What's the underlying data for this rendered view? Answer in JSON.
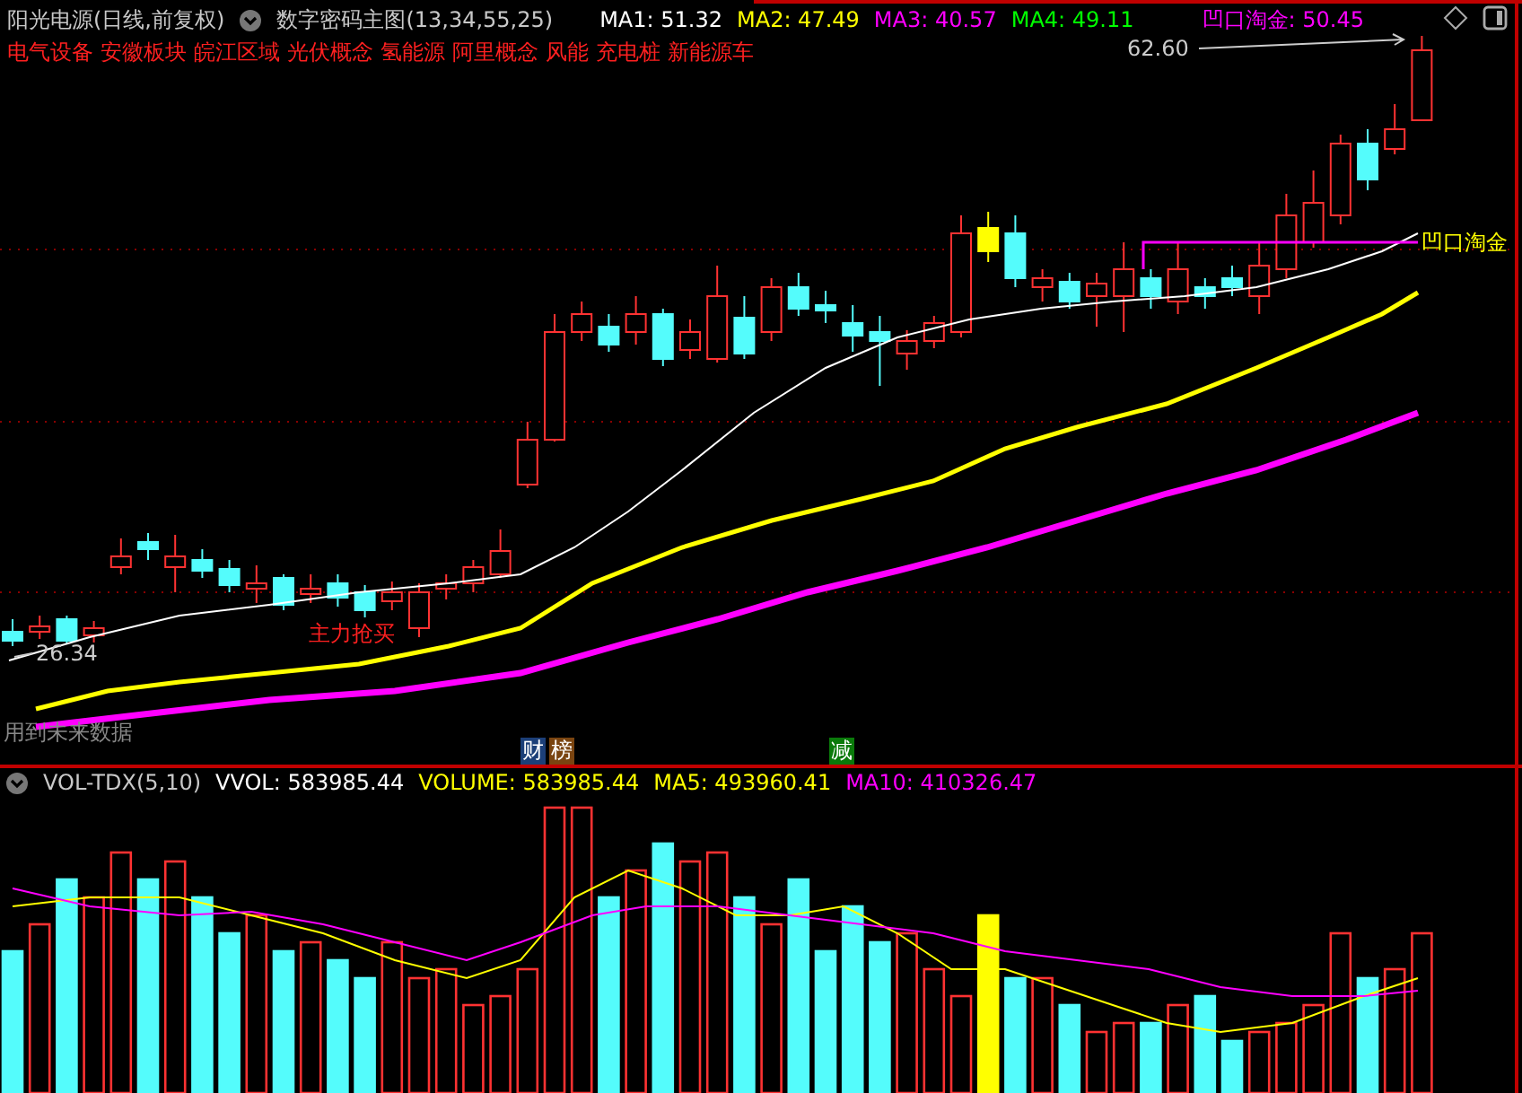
{
  "header": {
    "stock": "阳光电源(日线,前复权)",
    "indicator": "数字密码主图(13,34,55,25)",
    "values": [
      {
        "label": "MA1: 51.32",
        "color": "#ffffff"
      },
      {
        "label": "MA2: 47.49",
        "color": "#ffff00"
      },
      {
        "label": "MA3: 40.57",
        "color": "#ff00ff"
      },
      {
        "label": "MA4: 49.11",
        "color": "#00ff00"
      },
      {
        "label": "凹口淘金: 50.45",
        "color": "#ff00ff"
      }
    ]
  },
  "tags": [
    "电气设备",
    "安徽板块",
    "皖江区域",
    "光伏概念",
    "氢能源",
    "阿里概念",
    "风能",
    "充电桩",
    "新能源车"
  ],
  "main_chart": {
    "high_label": "62.60",
    "low_label": "26.34",
    "signal_label": "主力抢买",
    "line_label": "凹口淘金",
    "warning": "用到未来数据",
    "badges": [
      {
        "text": "财",
        "color": "#1c3f78"
      },
      {
        "text": "榜",
        "color": "#7a4410"
      },
      {
        "text": "减",
        "color": "#0a7a0a"
      }
    ]
  },
  "volume_panel": {
    "indicator": "VOL-TDX(5,10)",
    "values": [
      {
        "label": "VVOL: 583985.44",
        "color": "#ffffff"
      },
      {
        "label": "VOLUME: 583985.44",
        "color": "#ffff00"
      },
      {
        "label": "MA5: 493960.41",
        "color": "#ffff00"
      },
      {
        "label": "MA10: 410326.47",
        "color": "#ff00ff"
      }
    ]
  }
}
